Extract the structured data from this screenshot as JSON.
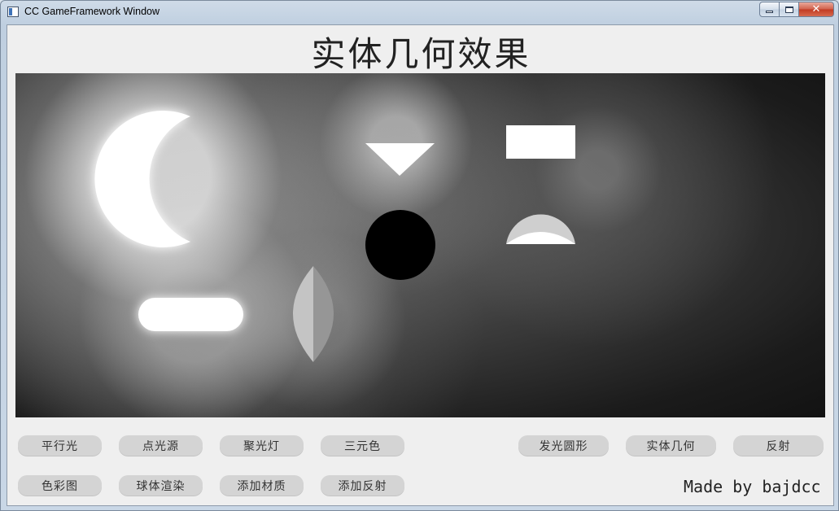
{
  "window": {
    "title": "CC GameFramework Window",
    "controls": {
      "close_glyph": "✕"
    }
  },
  "main": {
    "heading": "实体几何效果",
    "credit": "Made by bajdcc"
  },
  "buttons": {
    "row1": [
      "平行光",
      "点光源",
      "聚光灯",
      "三元色",
      "发光圆形",
      "实体几何",
      "反射"
    ],
    "row2": [
      "色彩图",
      "球体渲染",
      "添加材质",
      "添加反射"
    ]
  },
  "scene": {
    "shapes": [
      "crescent",
      "triangle",
      "rectangle",
      "circle",
      "semicircle-lens",
      "capsule",
      "lens"
    ],
    "colors": {
      "emissive": "#ffffff",
      "solid_dark": "#000000",
      "lens_light": "#c4c4c4",
      "lens_dark": "#969696"
    }
  }
}
